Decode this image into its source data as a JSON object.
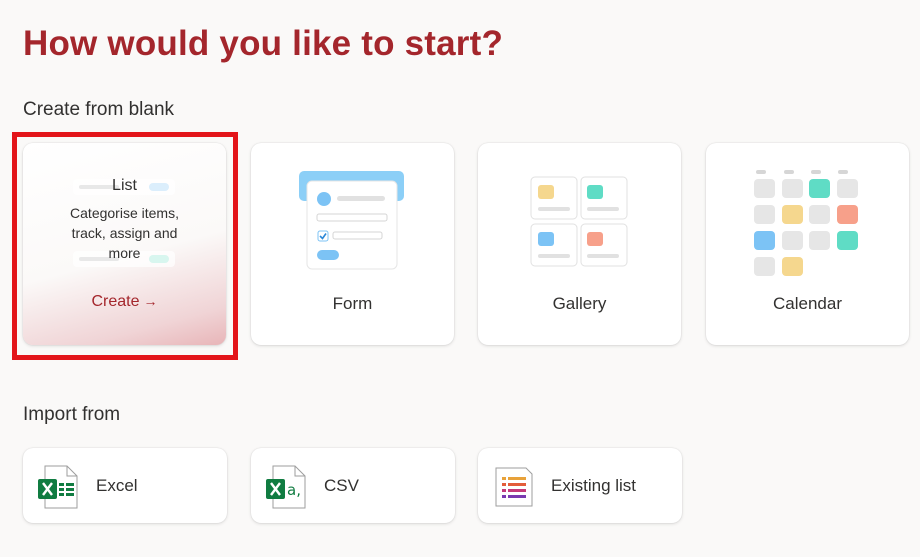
{
  "page_title": "How would you like to start?",
  "sections": {
    "blank": {
      "title": "Create from blank",
      "cards": [
        {
          "label": "List",
          "description": "Categorise items, track, assign and more",
          "action": "Create",
          "action_icon": "arrow-right-icon"
        },
        {
          "label": "Form",
          "icon": "form-illustration"
        },
        {
          "label": "Gallery",
          "icon": "gallery-illustration"
        },
        {
          "label": "Calendar",
          "icon": "calendar-illustration"
        }
      ]
    },
    "import": {
      "title": "Import from",
      "cards": [
        {
          "label": "Excel",
          "icon": "excel-file-icon"
        },
        {
          "label": "CSV",
          "icon": "csv-file-icon"
        },
        {
          "label": "Existing list",
          "icon": "existing-list-icon"
        }
      ]
    }
  },
  "colors": {
    "accent": "#a4262c",
    "highlight": "#e3151a",
    "excel_green": "#107c41",
    "tile_yellow": "#f5d78e",
    "tile_teal": "#5fdcc5",
    "tile_blue": "#7cc3f5",
    "tile_salmon": "#f7a08a"
  }
}
